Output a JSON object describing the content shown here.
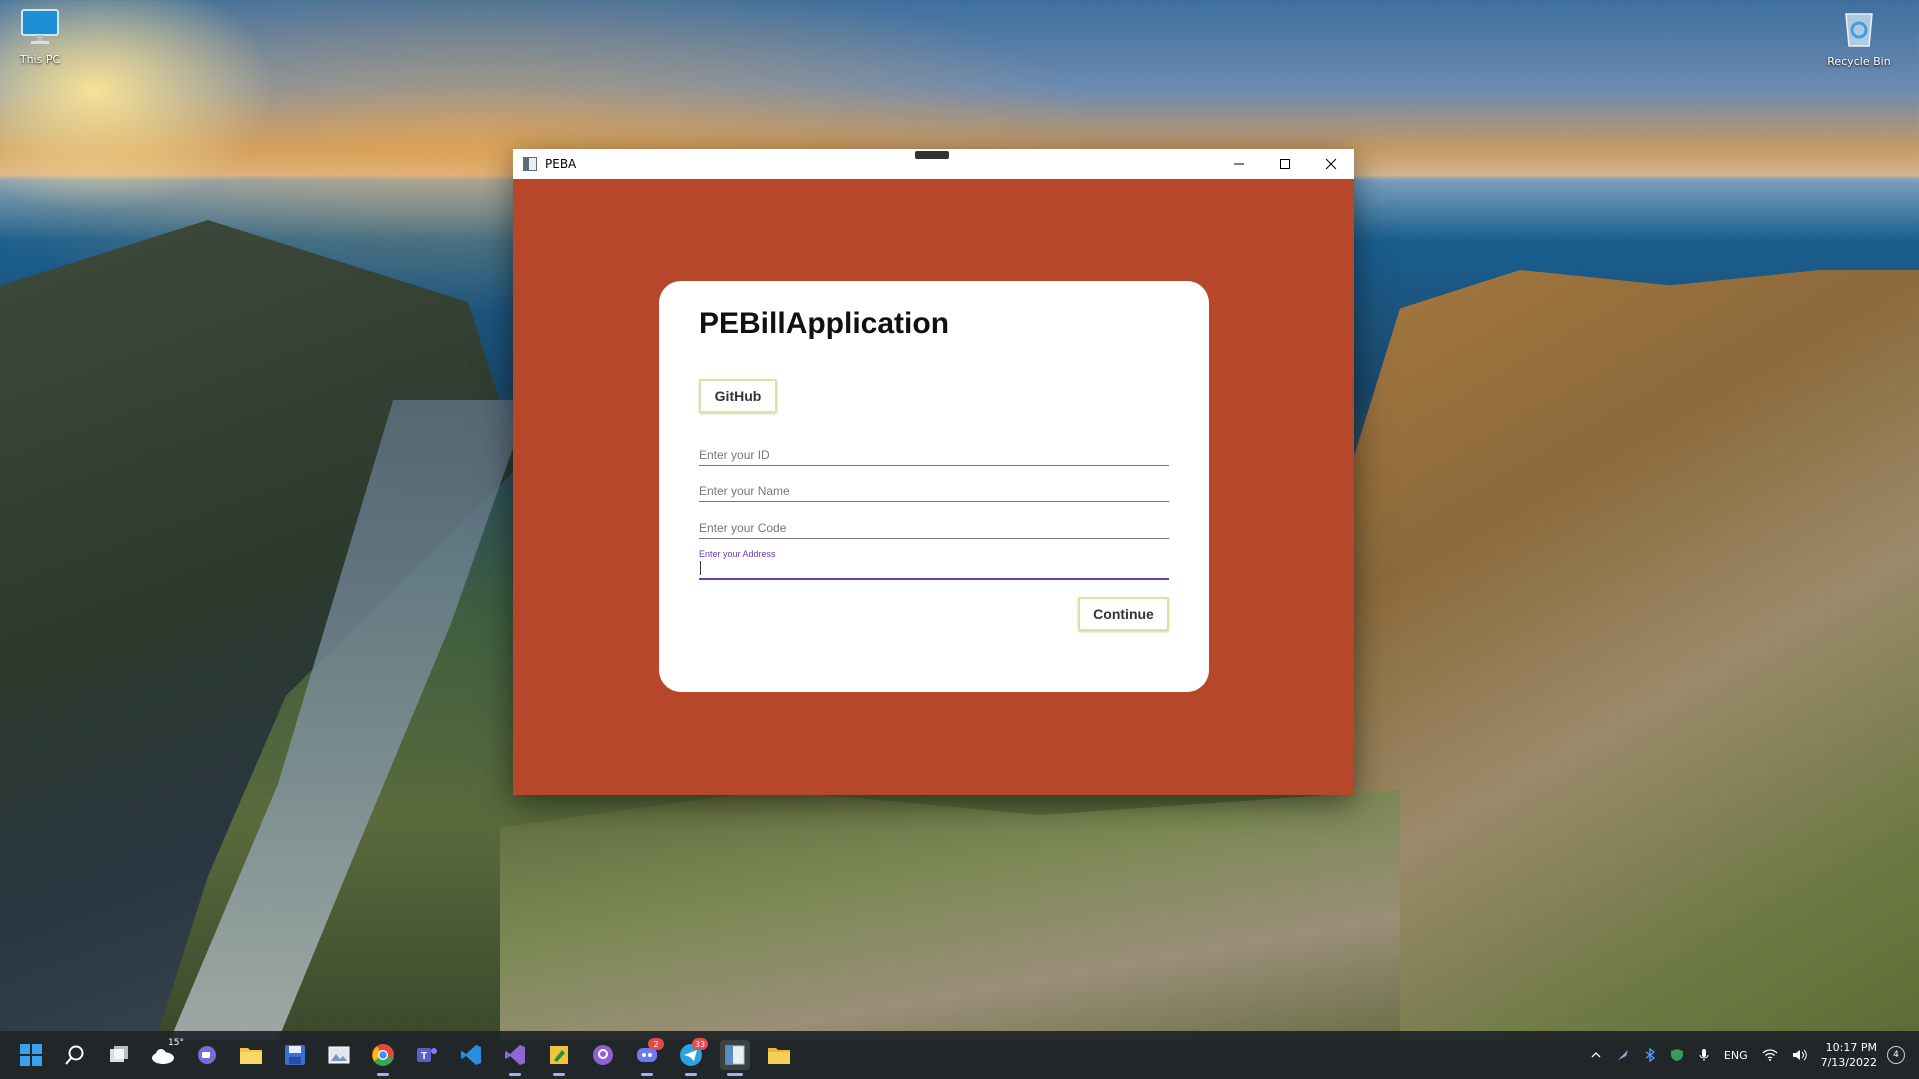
{
  "desktop": {
    "icons": [
      {
        "label": "This PC"
      },
      {
        "label": "Recycle Bin"
      }
    ]
  },
  "window": {
    "title": "PEBA",
    "app": {
      "heading": "PEBillApplication",
      "github_label": "GitHub",
      "fields": [
        {
          "placeholder": "Enter your ID"
        },
        {
          "placeholder": "Enter your Name"
        },
        {
          "placeholder": "Enter your Code"
        },
        {
          "placeholder": "Enter your Address"
        }
      ],
      "continue_label": "Continue"
    },
    "colors": {
      "background": "#b7472a",
      "button_border": "#d8e4a0",
      "focus": "#6a3ab7"
    }
  },
  "taskbar": {
    "weather_temp": "15°",
    "discord_badge": "2",
    "telegram_badge": "33",
    "tray": {
      "language": "ENG",
      "time": "10:17 PM",
      "date": "7/13/2022",
      "notifications": "4"
    }
  }
}
